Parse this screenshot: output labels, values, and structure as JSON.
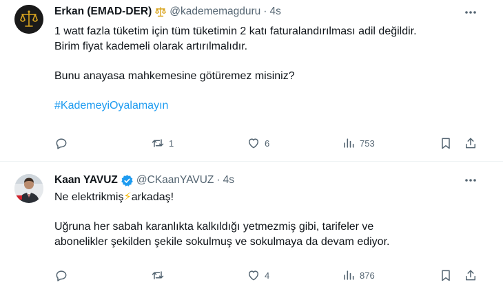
{
  "tweets": [
    {
      "author_name": "Erkan (EMAD-DER)",
      "badge": "scales-of-justice",
      "handle": "@kadememagduru",
      "separator": "·",
      "time": "4s",
      "lines": [
        "1 watt fazla tüketim için tüm tüketimin 2 katı faturalandırılması adil değildir.",
        "Birim fiyat kademeli olarak artırılmalıdır.",
        "Bunu anayasa mahkemesine götüremez misiniz?"
      ],
      "hashtag": "#KademeyiOyalamayın",
      "actions": {
        "reply": "",
        "retweet": "1",
        "like": "6",
        "views": "753"
      }
    },
    {
      "author_name": "Kaan YAVUZ",
      "badge": "verified",
      "handle": "@CKaanYAVUZ",
      "separator": "·",
      "time": "4s",
      "line1_before": "Ne elektrikmiş",
      "emoji": "⚡",
      "line1_after": "arkadaş!",
      "lines": [
        "Uğruna her sabah karanlıkta kalkıldığı yetmezmiş gibi, tarifeler ve",
        "abonelikler şekilden şekile sokulmuş ve sokulmaya da devam ediyor."
      ],
      "actions": {
        "reply": "",
        "retweet": "",
        "like": "4",
        "views": "876"
      }
    }
  ],
  "colors": {
    "text": "#0f1419",
    "secondary": "#536471",
    "link": "#1d9bf0",
    "divider": "#eff3f4",
    "badge_gold": "#d9a520"
  }
}
